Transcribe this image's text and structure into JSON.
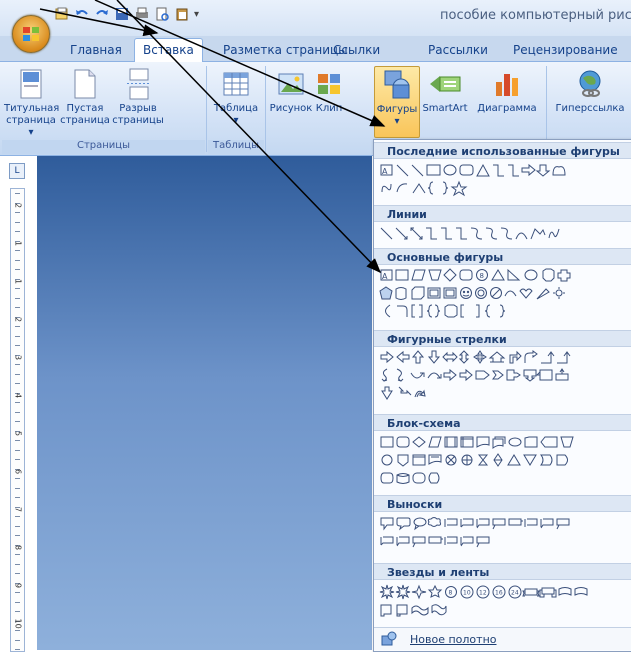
{
  "window": {
    "title": "пособие компьютерный рисуно"
  },
  "tabs": [
    {
      "label": "Главная",
      "active": false
    },
    {
      "label": "Вставка",
      "active": true
    },
    {
      "label": "Разметка страницы",
      "active": false
    },
    {
      "label": "Ссылки",
      "active": false
    },
    {
      "label": "Рассылки",
      "active": false
    },
    {
      "label": "Рецензирование",
      "active": false
    }
  ],
  "ribbon": {
    "groups": {
      "pages": "Страницы",
      "tables": "Таблицы"
    },
    "buttons": {
      "cover_page_l1": "Титульная",
      "cover_page_l2": "страница ▾",
      "blank_page_l1": "Пустая",
      "blank_page_l2": "страница",
      "page_break_l1": "Разрыв",
      "page_break_l2": "страницы",
      "table": "Таблица",
      "table_arrow": "▾",
      "picture": "Рисунок",
      "clip": "Клип",
      "shapes": "Фигуры",
      "shapes_arrow": "▾",
      "smartart": "SmartArt",
      "chart": "Диаграмма",
      "hyperlink": "Гиперссылка"
    }
  },
  "ruler": {
    "corner": "L",
    "numbers": [
      "2",
      "1",
      "1",
      "2",
      "3",
      "4",
      "5",
      "6",
      "7",
      "8",
      "9",
      "10"
    ]
  },
  "shapes_menu": {
    "sections": {
      "recent": "Последние использованные фигуры",
      "lines": "Линии",
      "basic": "Основные фигуры",
      "block_arrows": "Фигурные стрелки",
      "flowchart": "Блок-схема",
      "callouts": "Выноски",
      "stars": "Звезды и ленты"
    },
    "new_canvas": "Новое полотно"
  },
  "colors": {
    "ribbon_text": "#15428b",
    "page_gradient_top": "#2f5c9b",
    "page_gradient_bottom": "#8eb0db",
    "shapes_button": "#f9c55a"
  }
}
